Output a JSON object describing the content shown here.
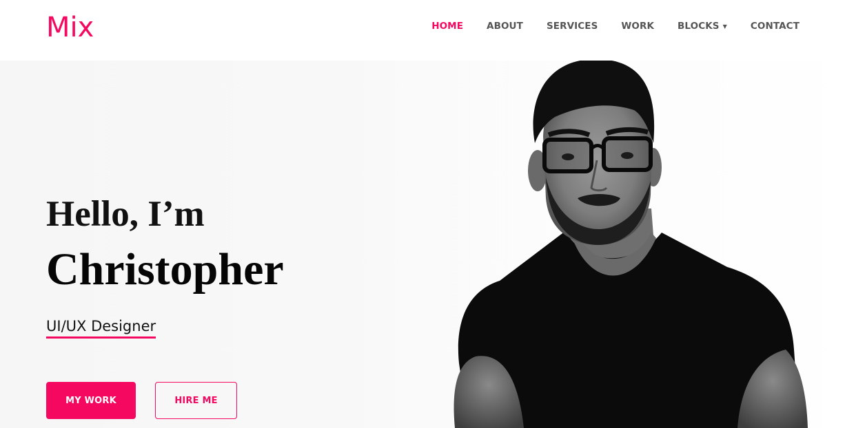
{
  "header": {
    "logo": "Mix",
    "nav": [
      {
        "label": "HOME",
        "active": true
      },
      {
        "label": "ABOUT",
        "active": false
      },
      {
        "label": "SERVICES",
        "active": false
      },
      {
        "label": "WORK",
        "active": false
      },
      {
        "label": "BLOCKS",
        "active": false,
        "dropdown": true
      },
      {
        "label": "CONTACT",
        "active": false
      }
    ]
  },
  "hero": {
    "greeting": "Hello, I’m",
    "name": "Christopher",
    "role": "UI/UX Designer",
    "primary_button": "MY WORK",
    "secondary_button": "HIRE ME"
  },
  "colors": {
    "accent": "#f5085f",
    "nav_text": "#555555",
    "heading": "#050505"
  },
  "icons": {
    "dropdown": "caret-down-icon"
  }
}
